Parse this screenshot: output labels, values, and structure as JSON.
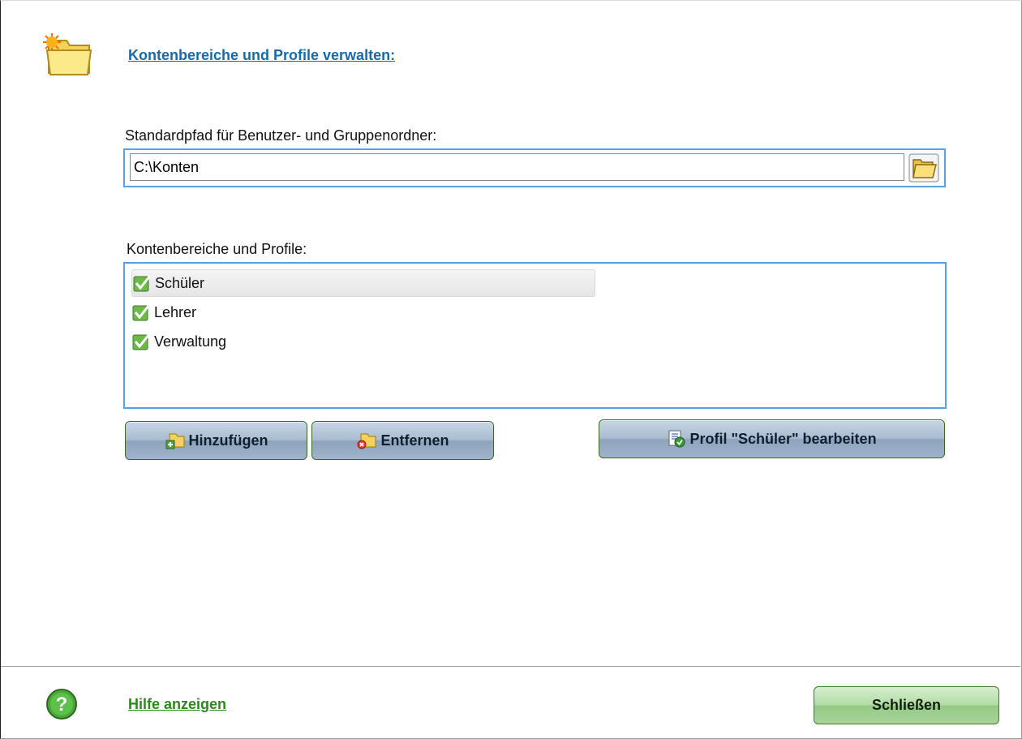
{
  "header": {
    "title": "Kontenbereiche und Profile verwalten:",
    "icon": "folder-new-icon"
  },
  "path_section": {
    "label": "Standardpfad für Benutzer- und Gruppenordner:",
    "value": "C:\\Konten",
    "browse_icon": "open-folder-icon"
  },
  "list_section": {
    "label": "Kontenbereiche und Profile:",
    "items": [
      {
        "label": "Schüler",
        "checked": true,
        "selected": true
      },
      {
        "label": "Lehrer",
        "checked": true,
        "selected": false
      },
      {
        "label": "Verwaltung",
        "checked": true,
        "selected": false
      }
    ]
  },
  "buttons": {
    "add": "Hinzufügen",
    "remove": "Entfernen",
    "edit_profile": "Profil \"Schüler\" bearbeiten"
  },
  "footer": {
    "help": "Hilfe anzeigen",
    "close": "Schließen"
  },
  "colors": {
    "title_link": "#1a6aa6",
    "help_link": "#2a8a1a",
    "focus_border": "#5aa0e0"
  }
}
